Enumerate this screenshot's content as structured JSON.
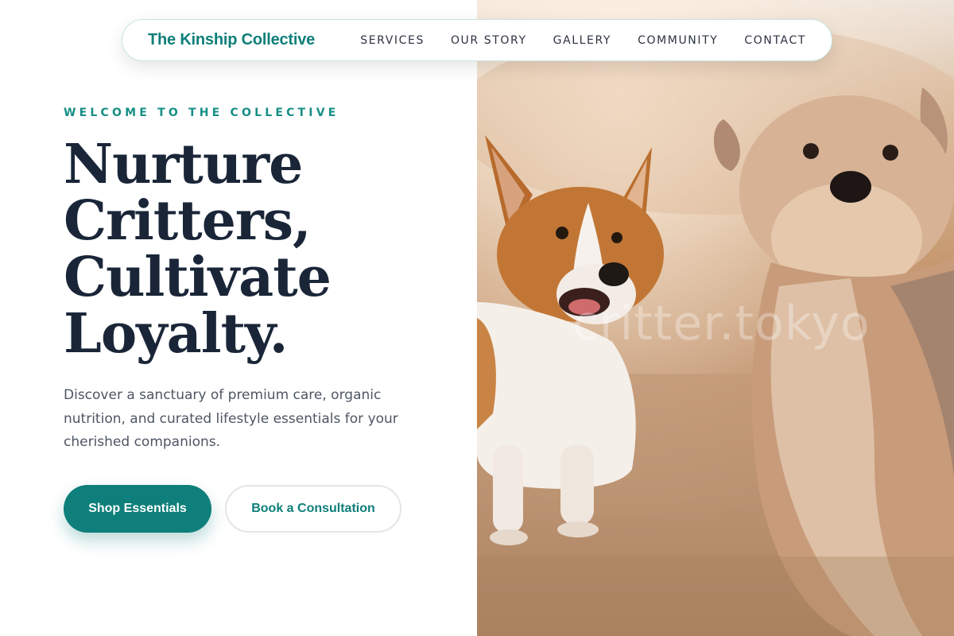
{
  "brand": {
    "name": "The Kinship Collective"
  },
  "nav": {
    "items": [
      "SERVICES",
      "OUR STORY",
      "GALLERY",
      "COMMUNITY",
      "CONTACT"
    ]
  },
  "hero": {
    "eyebrow": "WELCOME TO THE COLLECTIVE",
    "headline_lines": [
      "Nurture",
      "Critters,",
      "Cultivate",
      "Loyalty."
    ],
    "description": "Discover a sanctuary of premium care, organic nutrition, and curated lifestyle essentials for your cherished companions.",
    "primary_button": "Shop Essentials",
    "secondary_button": "Book a Consultation"
  },
  "image": {
    "watermark": "critter.tokyo",
    "subject": "corgi-and-terrier-photo"
  },
  "colors": {
    "accent": "#0e7f7a",
    "heading": "#1a2638",
    "body_text": "#4d5663",
    "eyebrow": "#178f86"
  }
}
